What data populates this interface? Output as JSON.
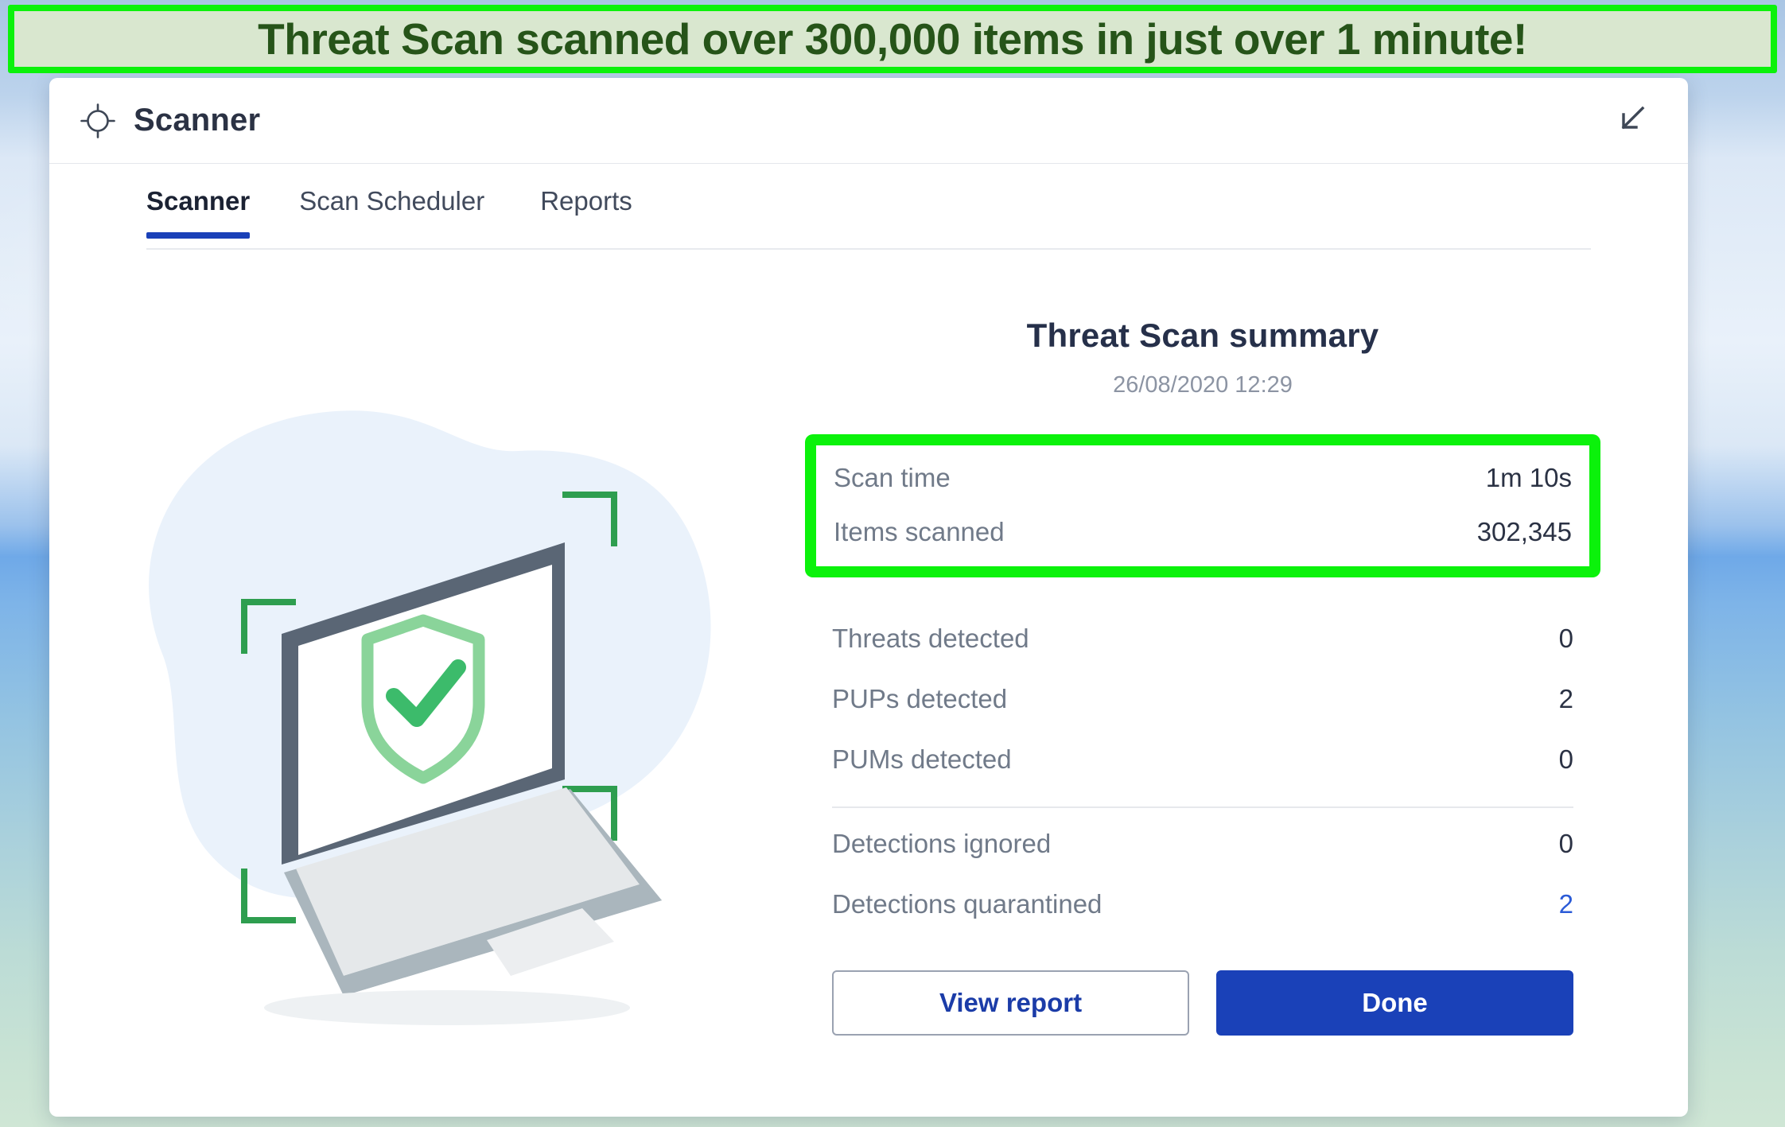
{
  "banner": {
    "text": "Threat Scan scanned over 300,000 items in just over 1 minute!",
    "border_color": "#0bf20b",
    "fill_color": "#d9e7cf",
    "text_color": "#265419"
  },
  "window": {
    "title": "Scanner",
    "title_icon": "crosshair-icon",
    "minimize_icon": "arrow-down-left-icon"
  },
  "tabs": [
    {
      "label": "Scanner",
      "active": true
    },
    {
      "label": "Scan Scheduler",
      "active": false
    },
    {
      "label": "Reports",
      "active": false
    }
  ],
  "illustration": {
    "name": "laptop-shield-scan-illustration",
    "blob_color": "#eaf2fb",
    "laptop_frame_color": "#5a6675",
    "laptop_base_color": "#d6dade",
    "laptop_shadow_color": "#a8b3bb",
    "shield_color": "#8ad49a",
    "check_color": "#3cbb6b",
    "bracket_color": "#2e9e4f"
  },
  "summary": {
    "title": "Threat Scan summary",
    "timestamp": "26/08/2020 12:29",
    "highlighted_stats": [
      {
        "label": "Scan time",
        "value": "1m 10s"
      },
      {
        "label": "Items scanned",
        "value": "302,345"
      }
    ],
    "detections": [
      {
        "label": "Threats detected",
        "value": "0",
        "link": false
      },
      {
        "label": "PUPs detected",
        "value": "2",
        "link": false
      },
      {
        "label": "PUMs detected",
        "value": "0",
        "link": false
      }
    ],
    "outcomes": [
      {
        "label": "Detections ignored",
        "value": "0",
        "link": false
      },
      {
        "label": "Detections quarantined",
        "value": "2",
        "link": true
      }
    ]
  },
  "actions": {
    "view_report_label": "View report",
    "done_label": "Done",
    "primary_color": "#1a41b8"
  }
}
